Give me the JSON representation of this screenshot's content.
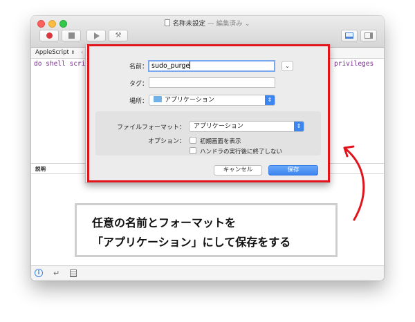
{
  "window": {
    "title": "名称未設定",
    "subtitle": "— 編集済み",
    "subtitle_chevron": "⌄"
  },
  "toolbar": {
    "buttons": [
      "record-button",
      "stop-button",
      "run-button",
      "compile-button"
    ],
    "hammer_glyph": "⚒"
  },
  "language_bar": {
    "language": "AppleScript",
    "updown_glyph": "⇕",
    "divider": "‹"
  },
  "editor": {
    "code_left": "do shell scri",
    "code_right": "privileges"
  },
  "description_pane": {
    "label": "説明"
  },
  "save_sheet": {
    "name_label": "名前：",
    "name_value": "sudo_purge",
    "tag_label": "タグ：",
    "tag_value": "",
    "location_label": "場所：",
    "location_value": "アプリケーション",
    "expand_glyph": "⌄",
    "popup_arrows": "⇕",
    "format_label": "ファイルフォーマット：",
    "format_value": "アプリケーション",
    "options_label": "オプション：",
    "option_1": "初期画面を表示",
    "option_2": "ハンドラの実行後に終了しない",
    "cancel_button": "キャンセル",
    "save_button": "保存"
  },
  "annotation": {
    "line_1": "任意の名前とフォーマットを",
    "line_2": "「アプリケーション」にして保存をする",
    "highlight_color": "#e3131b"
  },
  "bottom_bar": {
    "info_glyph": "i",
    "return_glyph": "↵"
  },
  "colors": {
    "accent_blue": "#3b83ef",
    "code_purple": "#7a2b8f"
  }
}
